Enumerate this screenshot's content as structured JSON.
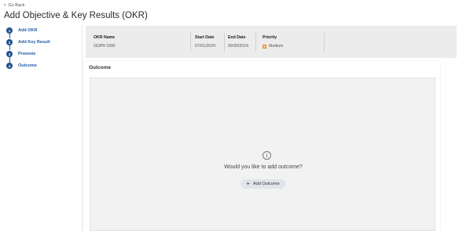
{
  "nav": {
    "go_back": "Go Back"
  },
  "page": {
    "title": "Add Objective & Key Results (OKR)"
  },
  "steps": [
    {
      "num": "1",
      "label": "Add OKR"
    },
    {
      "num": "2",
      "label": "Add Key Result"
    },
    {
      "num": "3",
      "label": "Promote"
    },
    {
      "num": "4",
      "label": "Outcome"
    }
  ],
  "summary": {
    "okr_name_label": "OKR Name",
    "okr_name_value": "GDPR OKR",
    "start_date_label": "Start Date",
    "start_date_value": "07/01/2024",
    "end_date_label": "End Date",
    "end_date_value": "09/30/2024",
    "priority_label": "Priority",
    "priority_value": "Medium",
    "priority_color": "#e0862a"
  },
  "outcome": {
    "title": "Outcome",
    "prompt": "Would you like to add outcome?",
    "add_button": "Add Outcome"
  },
  "icons": {
    "back": "chevron-left-icon",
    "info": "info-icon",
    "add": "plus-icon",
    "priority": "priority-square-icon"
  }
}
